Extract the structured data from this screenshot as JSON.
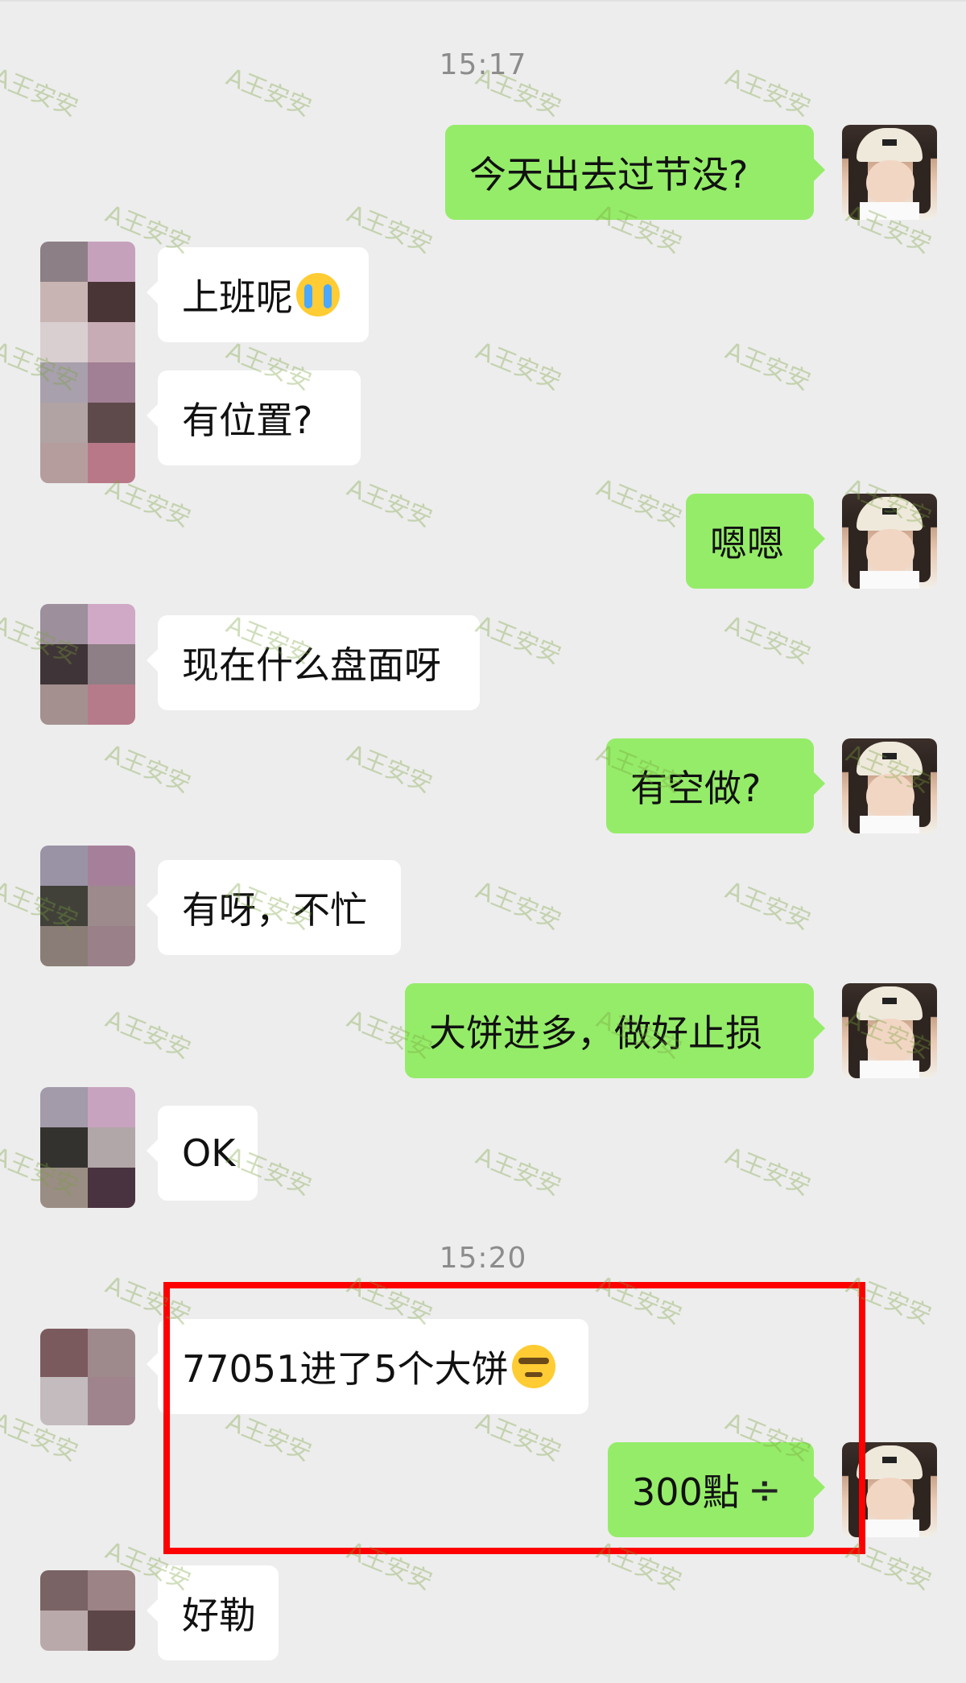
{
  "chat": {
    "timestamps": [
      "15:17",
      "15:20"
    ],
    "messages": [
      {
        "side": "right",
        "text": "今天出去过节没?"
      },
      {
        "side": "left",
        "text": "上班呢"
      },
      {
        "side": "left",
        "text": "有位置?"
      },
      {
        "side": "right",
        "text": "嗯嗯"
      },
      {
        "side": "left",
        "text": "现在什么盘面呀"
      },
      {
        "side": "right",
        "text": "有空做?"
      },
      {
        "side": "left",
        "text": "有呀，不忙"
      },
      {
        "side": "right",
        "text": "大饼进多，做好止损"
      },
      {
        "side": "left",
        "text": "OK"
      },
      {
        "side": "left",
        "text": "77051进了5个大饼"
      },
      {
        "side": "right",
        "text": "300點"
      },
      {
        "side": "left",
        "text": "好勒"
      }
    ],
    "divide_symbol": "÷"
  },
  "watermark": "A王安安",
  "colors": {
    "background": "#ededed",
    "sent_bubble": "#95ec69",
    "received_bubble": "#ffffff",
    "highlight_box": "#ff0000"
  },
  "icons": {
    "cry": "loudly-crying-face-emoji",
    "smirk": "smirking-face-emoji"
  }
}
